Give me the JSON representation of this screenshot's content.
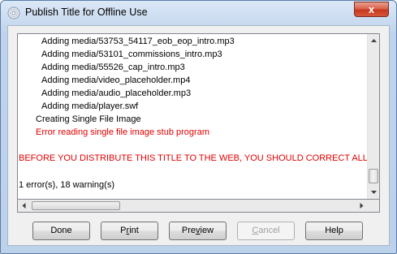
{
  "window": {
    "title": "Publish Title for Offline Use",
    "close_label": "x"
  },
  "log": {
    "lines": [
      {
        "text": "Adding media/53753_54117_eob_eop_intro.mp3",
        "color": "#000000"
      },
      {
        "text": "Adding media/53101_commissions_intro.mp3",
        "color": "#000000"
      },
      {
        "text": "Adding media/55526_cap_intro.mp3",
        "color": "#000000"
      },
      {
        "text": "Adding media/video_placeholder.mp4",
        "color": "#000000"
      },
      {
        "text": "Adding media/audio_placeholder.mp3",
        "color": "#000000"
      },
      {
        "text": "Adding media/player.swf",
        "color": "#000000"
      },
      {
        "text": "Creating Single File Image",
        "color": "#000000"
      },
      {
        "text": "Error reading single file image stub program",
        "color": "#e00000"
      },
      {
        "text": "BEFORE YOU DISTRIBUTE THIS TITLE TO THE WEB, YOU SHOULD CORRECT ALL THE ERR",
        "color": "#e00000"
      },
      {
        "text": "1 error(s), 18 warning(s)",
        "color": "#000000"
      }
    ]
  },
  "buttons": {
    "done": {
      "pre": "Done",
      "u": "",
      "post": ""
    },
    "print": {
      "pre": "P",
      "u": "r",
      "post": "int"
    },
    "preview": {
      "pre": "Pre",
      "u": "v",
      "post": "iew"
    },
    "cancel": {
      "pre": "",
      "u": "C",
      "post": "ancel"
    },
    "help": {
      "pre": "Help",
      "u": "",
      "post": ""
    }
  },
  "colors": {
    "error_text": "#e00000",
    "title_bar": "#c8daef",
    "close_button": "#c6391f"
  }
}
